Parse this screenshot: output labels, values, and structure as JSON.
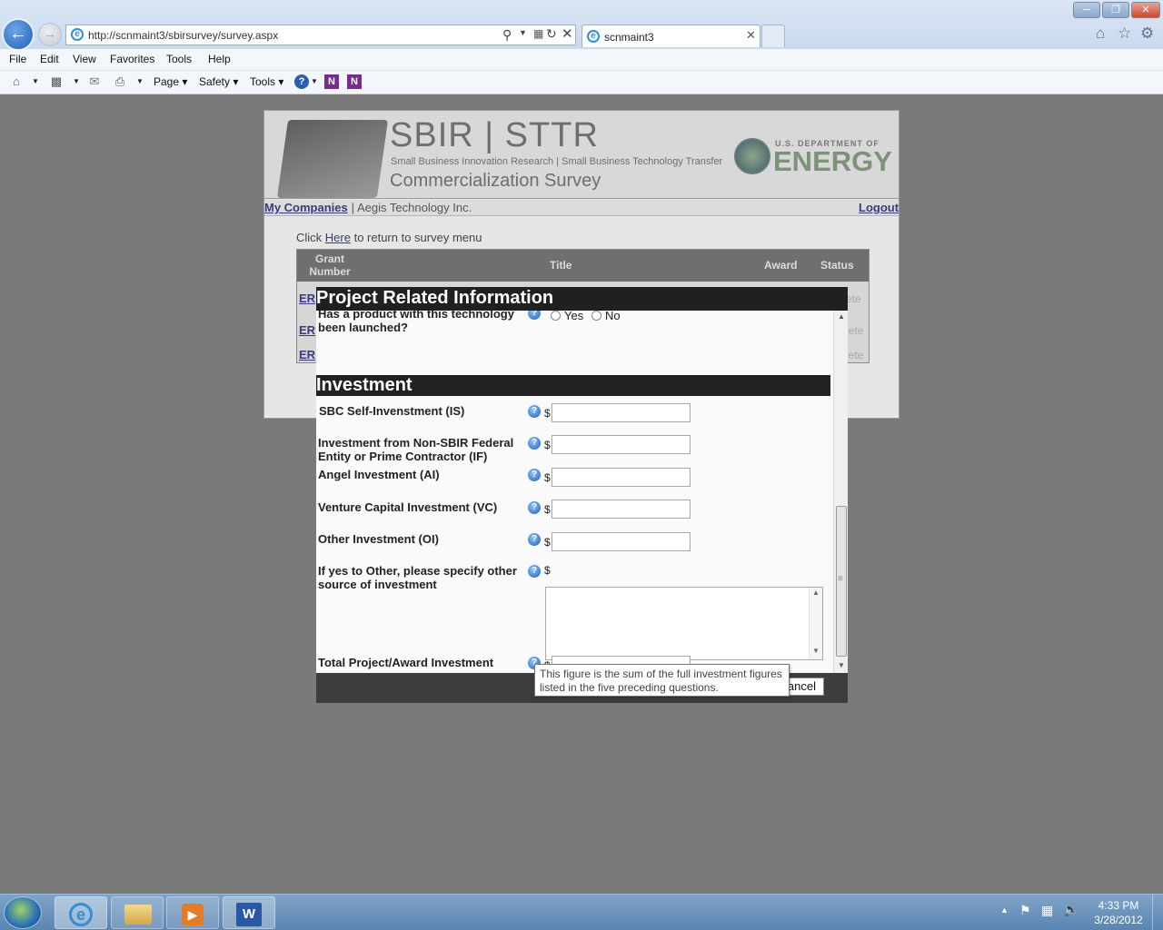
{
  "browser": {
    "url": "http://scnmaint3/sbirsurvey/survey.aspx",
    "tab_title": "scnmaint3",
    "menu": [
      "File",
      "Edit",
      "View",
      "Favorites",
      "Tools",
      "Help"
    ],
    "commands": {
      "page": "Page",
      "safety": "Safety",
      "tools": "Tools"
    }
  },
  "banner": {
    "brand": "SBIR | STTR",
    "tagline": "Small Business Innovation Research | Small Business Technology Transfer",
    "subtitle": "Commercialization Survey",
    "doe_small": "U.S. DEPARTMENT OF",
    "doe_big": "ENERGY"
  },
  "nav": {
    "my_companies": "My Companies",
    "separator": " | ",
    "company": "Aegis Technology Inc.",
    "logout": "Logout"
  },
  "return_line": {
    "before": "Click ",
    "link": "Here",
    "after": " to return to survey menu"
  },
  "bg_table": {
    "headers": [
      "Grant Number",
      "Title",
      "Award",
      "Status"
    ],
    "row_prefix": [
      "ER",
      "ER",
      "ER"
    ],
    "row_status": [
      "ete",
      "lete",
      "lete"
    ]
  },
  "modal": {
    "title": "Project Related Information",
    "launched_question": "Has a product with this technology been launched?",
    "yes": "Yes",
    "no": "No",
    "section": "Investment",
    "currency": "$",
    "fields": [
      {
        "label": "SBC Self-Invenstment (IS)",
        "value": ""
      },
      {
        "label": "Investment from Non-SBIR Federal Entity or Prime Contractor (IF)",
        "value": ""
      },
      {
        "label": "Angel Investment (AI)",
        "value": ""
      },
      {
        "label": "Venture Capital Investment (VC)",
        "value": ""
      },
      {
        "label": "Other Investment (OI)",
        "value": ""
      }
    ],
    "other_label": "If yes to Other, please specify other source of investment",
    "total_label": "Total Project/Award Investment",
    "total_value": "",
    "tooltip": "This figure is the sum of the full investment figures listed in the five preceding questions.",
    "cancel": "ancel"
  },
  "taskbar": {
    "time": "4:33 PM",
    "date": "3/28/2012"
  }
}
